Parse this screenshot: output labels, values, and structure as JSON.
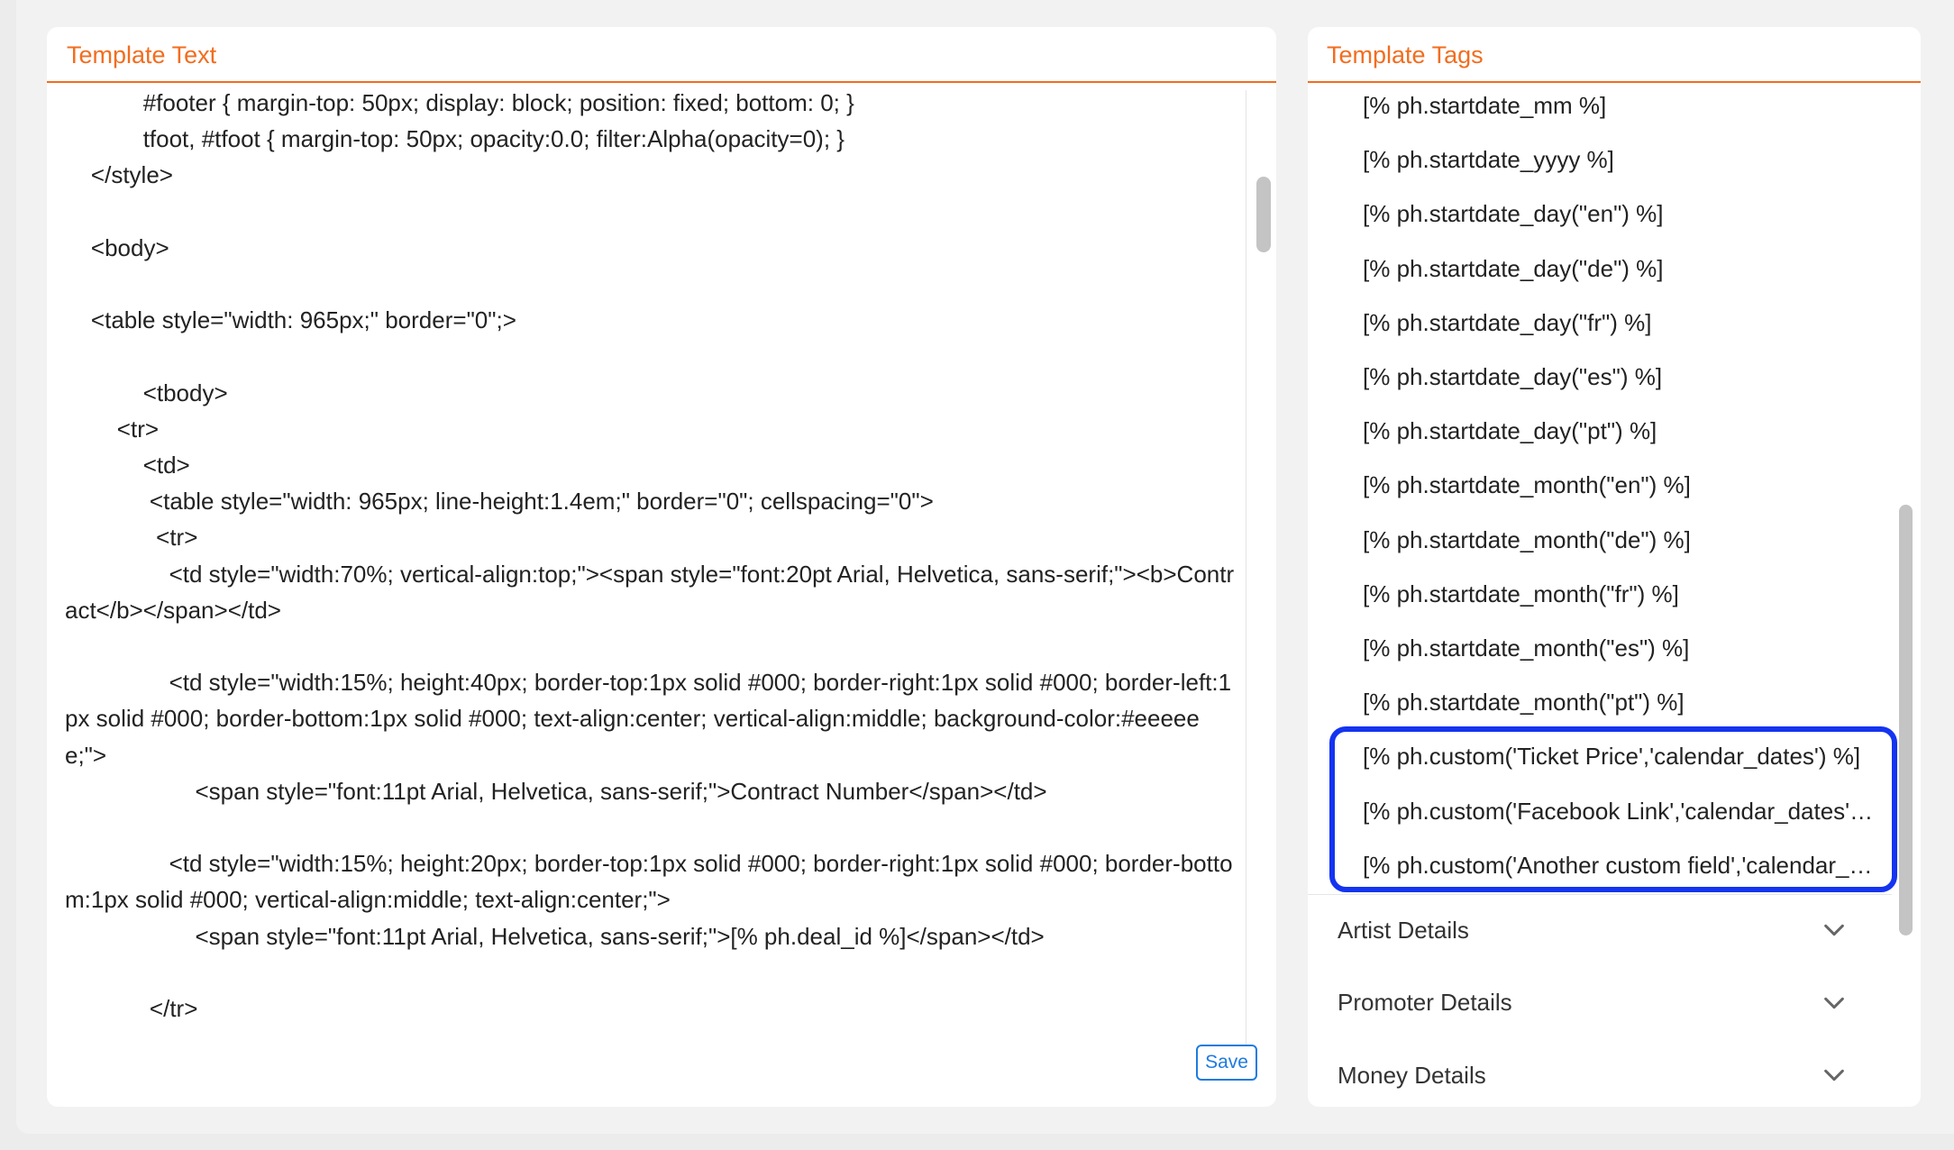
{
  "template_text": {
    "title": "Template Text",
    "code_lines": [
      "            #footer { margin-top: 50px; display: block; position: fixed; bottom: 0; }",
      "            tfoot, #tfoot { margin-top: 50px; opacity:0.0; filter:Alpha(opacity=0); }",
      "    </style>",
      "",
      "    <body>",
      "",
      "    <table style=\"width: 965px;\" border=\"0\";>",
      "",
      "            <tbody>",
      "        <tr>",
      "            <td>",
      "             <table style=\"width: 965px; line-height:1.4em;\" border=\"0\"; cellspacing=\"0\">",
      "              <tr>",
      "                <td style=\"width:70%; vertical-align:top;\"><span style=\"font:20pt Arial, Helvetica, sans-serif;\"><b>Contract</b></span></td>",
      "",
      "                <td style=\"width:15%; height:40px; border-top:1px solid #000; border-right:1px solid #000; border-left:1px solid #000; border-bottom:1px solid #000; text-align:center; vertical-align:middle; background-color:#eeeeee;\">",
      "                    <span style=\"font:11pt Arial, Helvetica, sans-serif;\">Contract Number</span></td>",
      "",
      "                <td style=\"width:15%; height:20px; border-top:1px solid #000; border-right:1px solid #000; border-bottom:1px solid #000; vertical-align:middle; text-align:center;\">",
      "                    <span style=\"font:11pt Arial, Helvetica, sans-serif;\">[% ph.deal_id %]</span></td>",
      "",
      "             </tr>"
    ],
    "save_label": "Save"
  },
  "template_tags": {
    "title": "Template Tags",
    "tags": [
      "[% ph.startdate_mm %]",
      "[% ph.startdate_yyyy %]",
      "[% ph.startdate_day(\"en\") %]",
      "[% ph.startdate_day(\"de\") %]",
      "[% ph.startdate_day(\"fr\") %]",
      "[% ph.startdate_day(\"es\") %]",
      "[% ph.startdate_day(\"pt\") %]",
      "[% ph.startdate_month(\"en\") %]",
      "[% ph.startdate_month(\"de\") %]",
      "[% ph.startdate_month(\"fr\") %]",
      "[% ph.startdate_month(\"es\") %]",
      "[% ph.startdate_month(\"pt\") %]",
      "[% ph.custom('Ticket Price','calendar_dates') %]",
      "[% ph.custom('Facebook Link','calendar_dates') %]",
      "[% ph.custom('Another custom field','calendar_dates') %]"
    ],
    "sections": [
      {
        "label": "Artist Details",
        "icon": "chevron-down-icon"
      },
      {
        "label": "Promoter Details",
        "icon": "chevron-down-icon"
      },
      {
        "label": "Money Details",
        "icon": "chevron-down-icon"
      }
    ]
  },
  "colors": {
    "accent": "#f26d1f",
    "highlight": "#1434f0",
    "save_button": "#1e7be0"
  }
}
